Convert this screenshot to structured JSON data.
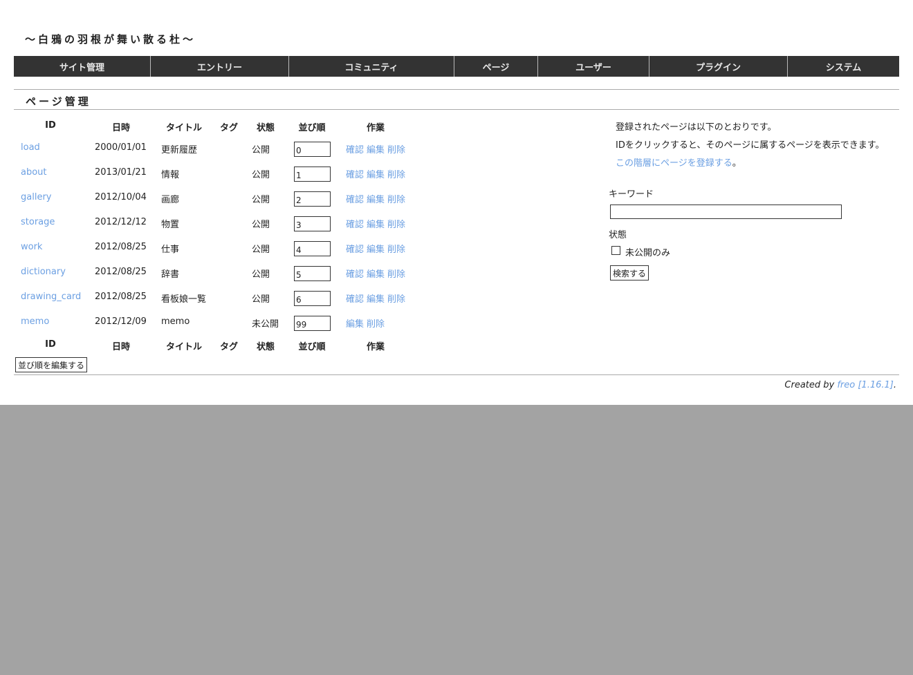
{
  "site": {
    "title": "～白鴉の羽根が舞い散る杜～"
  },
  "nav": {
    "items": [
      {
        "label": "サイト管理"
      },
      {
        "label": "エントリー"
      },
      {
        "label": "コミュニティ"
      },
      {
        "label": "ページ"
      },
      {
        "label": "ユーザー"
      },
      {
        "label": "プラグイン"
      },
      {
        "label": "システム"
      }
    ]
  },
  "page": {
    "heading": "ページ管理"
  },
  "table": {
    "headers": {
      "id": "ID",
      "date": "日時",
      "title": "タイトル",
      "tag": "タグ",
      "status": "状態",
      "order": "並び順",
      "action": "作業"
    },
    "actions": {
      "view": "確認",
      "edit": "編集",
      "delete": "削除"
    },
    "rows": [
      {
        "id": "load",
        "date": "2000/01/01",
        "title": "更新履歴",
        "tag": "",
        "status": "公開",
        "order": "0"
      },
      {
        "id": "about",
        "date": "2013/01/21",
        "title": "情報",
        "tag": "",
        "status": "公開",
        "order": "1"
      },
      {
        "id": "gallery",
        "date": "2012/10/04",
        "title": "画廊",
        "tag": "",
        "status": "公開",
        "order": "2"
      },
      {
        "id": "storage",
        "date": "2012/12/12",
        "title": "物置",
        "tag": "",
        "status": "公開",
        "order": "3"
      },
      {
        "id": "work",
        "date": "2012/08/25",
        "title": "仕事",
        "tag": "",
        "status": "公開",
        "order": "4"
      },
      {
        "id": "dictionary",
        "date": "2012/08/25",
        "title": "辞書",
        "tag": "",
        "status": "公開",
        "order": "5"
      },
      {
        "id": "drawing_card",
        "date": "2012/08/25",
        "title": "看板娘一覧",
        "tag": "",
        "status": "公開",
        "order": "6"
      },
      {
        "id": "memo",
        "date": "2012/12/09",
        "title": "memo",
        "tag": "",
        "status": "未公開",
        "order": "99"
      }
    ],
    "save_order_label": "並び順を編集する"
  },
  "sidebar": {
    "info_line1": "登録されたページは以下のとおりです。",
    "info_line2": "IDをクリックすると、そのページに属するページを表示できます。",
    "register_link": "この階層にページを登録する",
    "register_suffix": "。",
    "keyword_label": "キーワード",
    "keyword_value": "",
    "status_label": "状態",
    "unpublished_only_label": "未公開のみ",
    "search_button": "検索する"
  },
  "footer": {
    "prefix": "Created by ",
    "link": "freo [1.16.1]",
    "suffix": "."
  },
  "colors": {
    "link": "#6b9fe2",
    "nav_bg": "#333333",
    "backdrop": "#a3a3a3"
  }
}
